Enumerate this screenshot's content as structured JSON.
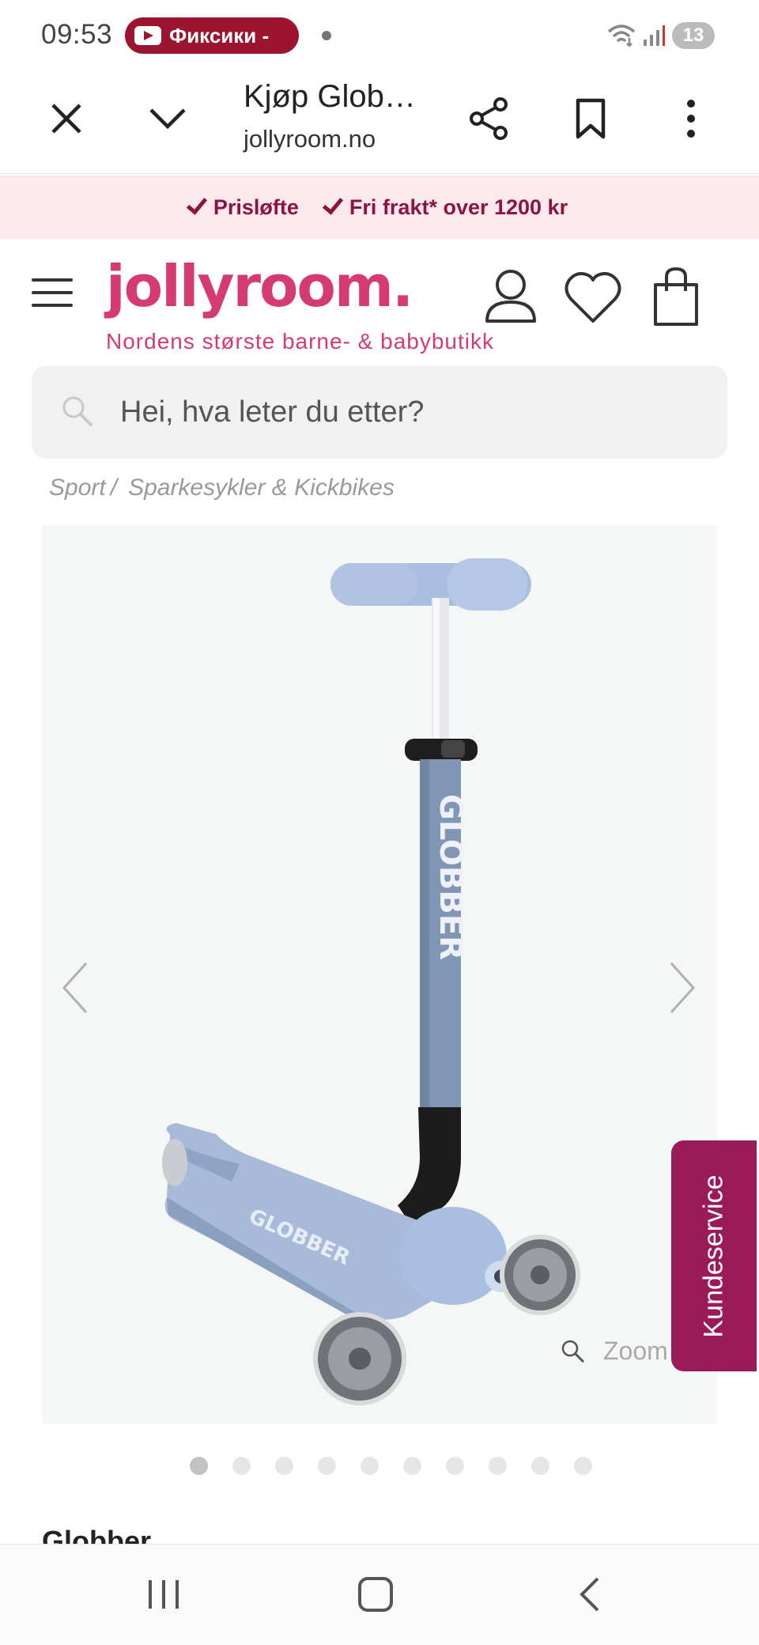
{
  "status_bar": {
    "time": "09:53",
    "notification_pill": "Фиксики -",
    "battery": "13"
  },
  "browser": {
    "title": "Kjøp Glob…",
    "url": "jollyroom.no"
  },
  "promo": {
    "items": [
      "Prisløfte",
      "Fri frakt* over 1200 kr"
    ]
  },
  "header": {
    "logo": "jollyroom.",
    "tagline": "Nordens største barne- & babybutikk"
  },
  "search": {
    "placeholder": "Hei, hva leter du etter?"
  },
  "breadcrumb": {
    "items": [
      "Sport",
      "Sparkesykler & Kickbikes"
    ],
    "separator": "/"
  },
  "gallery": {
    "zoom_label": "Zoom",
    "image_count": 10,
    "active_index": 0
  },
  "customer_service": {
    "label": "Kundeservice"
  },
  "product": {
    "brand": "Globber"
  },
  "colors": {
    "brand": "#d63a72",
    "promo_bg": "#fce9ec",
    "promo_text": "#8c1443",
    "service_tab": "#9b1a5a"
  }
}
